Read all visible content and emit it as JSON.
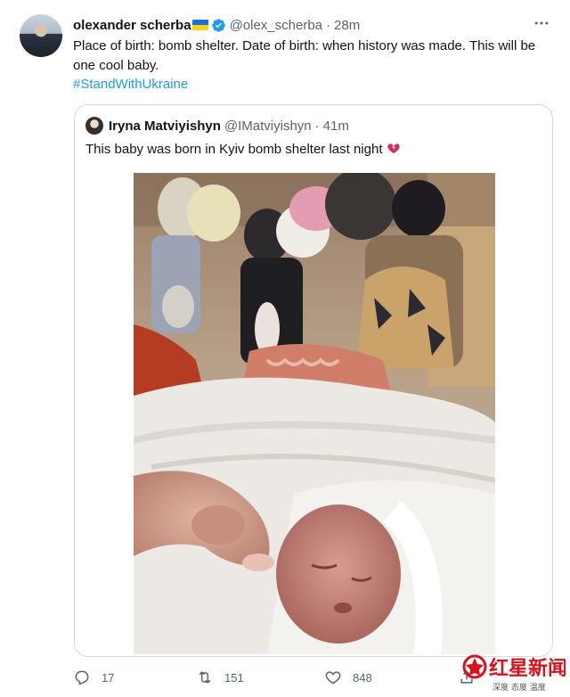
{
  "tweet": {
    "author_name": "olexander scherba",
    "handle": "@olex_scherba",
    "separator": "·",
    "time": "28m",
    "text": "Place of birth: bomb shelter. Date of birth: when history was made. This will be one cool baby.",
    "hashtag": "#StandWithUkraine",
    "flag_colors": [
      "#1f6fd6",
      "#f7d31c"
    ],
    "verified_icon": "verified-badge-icon",
    "more_icon": "more-dots-icon"
  },
  "quote": {
    "author_name": "Iryna Matviyishyn",
    "handle": "@IMatviyishyn",
    "separator": "·",
    "time": "41m",
    "text": "This baby was born in Kyiv bomb shelter last night",
    "emoji_icon": "broken-heart-icon",
    "image_icon": "photo-newborn-in-shelter"
  },
  "actions": {
    "reply_count": "17",
    "retweet_count": "151",
    "like_count": "848",
    "reply_icon": "reply-icon",
    "retweet_icon": "retweet-icon",
    "like_icon": "heart-icon",
    "share_icon": "share-icon"
  },
  "watermark": {
    "title": "红星新闻",
    "subtitle": "深度 态度 温度"
  },
  "colors": {
    "link": "#1d9bf0",
    "secondary_text": "#536471",
    "border": "#cfd9de",
    "watermark_red": "#d8121c"
  }
}
